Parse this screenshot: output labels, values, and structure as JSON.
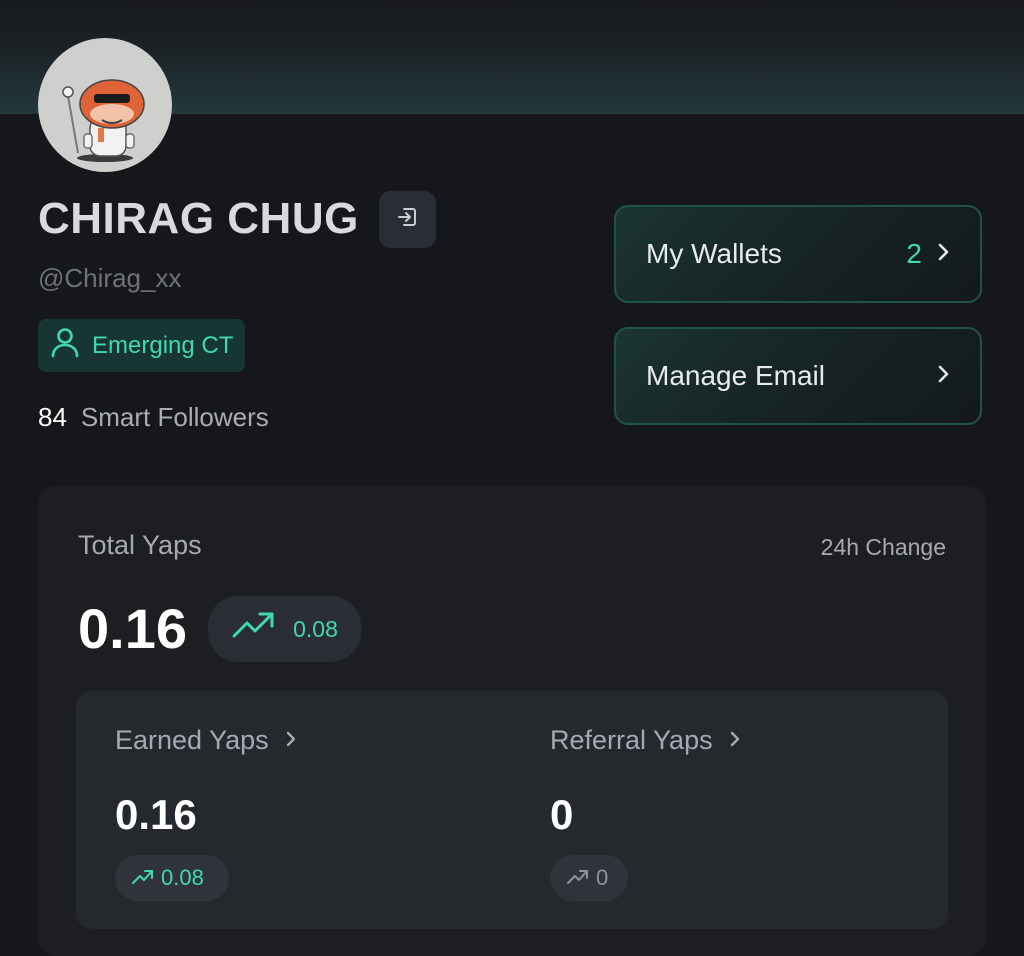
{
  "profile": {
    "name": "CHIRAG CHUG",
    "handle": "@Chirag_xx",
    "badge_label": "Emerging CT",
    "smart_followers_count": "84",
    "smart_followers_label": "Smart Followers"
  },
  "actions": {
    "wallets_label": "My Wallets",
    "wallets_count": "2",
    "email_label": "Manage Email"
  },
  "yaps": {
    "title": "Total Yaps",
    "change_label": "24h Change",
    "total": "0.16",
    "total_change": "0.08",
    "earned": {
      "label": "Earned Yaps",
      "value": "0.16",
      "change": "0.08"
    },
    "referral": {
      "label": "Referral Yaps",
      "value": "0",
      "change": "0"
    }
  },
  "colors": {
    "accent": "#3fd8b4",
    "background": "#15171b",
    "card": "#1c1e22"
  },
  "icons": {
    "logout": "logout-icon",
    "badge": "user-icon",
    "chevron": "chevron-right-icon",
    "trend": "trending-up-icon"
  }
}
